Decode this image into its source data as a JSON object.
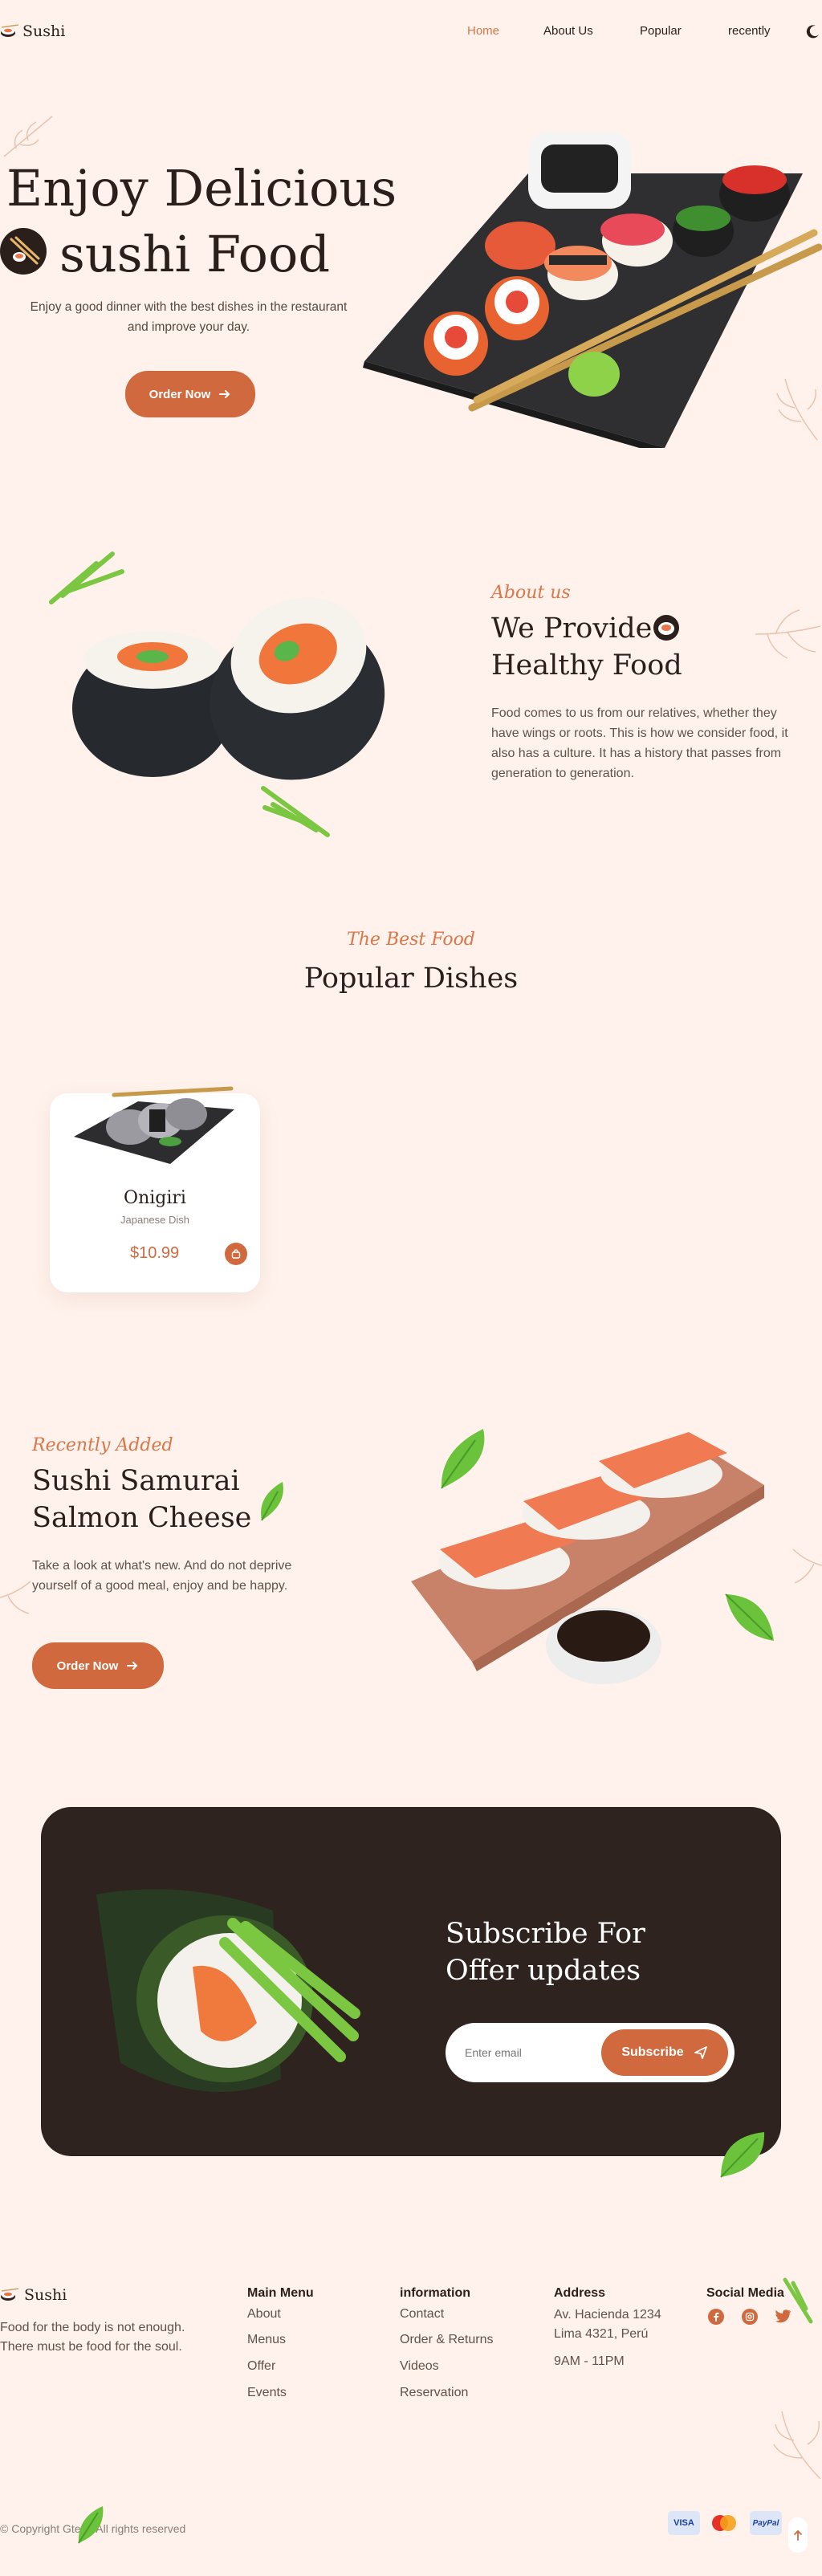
{
  "header": {
    "logo_text": "Sushi",
    "nav": [
      {
        "label": "Home",
        "active": true
      },
      {
        "label": "About Us",
        "active": false
      },
      {
        "label": "Popular",
        "active": false
      },
      {
        "label": "recently",
        "active": false
      }
    ],
    "theme_toggle_icon": "moon-icon"
  },
  "hero": {
    "title_line1": "Enjoy Delicious",
    "title_line2": "sushi Food",
    "description": "Enjoy a good dinner with the best dishes in the restaurant and improve your day.",
    "cta_label": "Order Now"
  },
  "about": {
    "label": "About us",
    "title_line1": "We Provide",
    "title_line2": "Healthy Food",
    "body": "Food comes to us from our relatives, whether they have wings or roots. This is how we consider food, it also has a culture. It has a history that passes from generation to generation."
  },
  "popular": {
    "label": "The Best Food",
    "title": "Popular Dishes",
    "items": [
      {
        "name": "Onigiri",
        "subtitle": "Japanese Dish",
        "price": "$10.99"
      }
    ]
  },
  "recent": {
    "label": "Recently Added",
    "title_line1": "Sushi Samurai",
    "title_line2": "Salmon Cheese",
    "body": "Take a look at what's new. And do not deprive yourself of a good meal, enjoy and be happy.",
    "cta_label": "Order Now"
  },
  "subscribe": {
    "title_line1": "Subscribe For",
    "title_line2": "Offer updates",
    "input_placeholder": "Enter email",
    "button_label": "Subscribe"
  },
  "footer": {
    "logo_text": "Sushi",
    "tagline": "Food for the body is not enough. There must be food for the soul.",
    "columns": [
      {
        "title": "Main Menu",
        "links": [
          "About",
          "Menus",
          "Offer",
          "Events"
        ]
      },
      {
        "title": "information",
        "links": [
          "Contact",
          "Order & Returns",
          "Videos",
          "Reservation"
        ]
      },
      {
        "title": "Address",
        "links": [
          "Av. Hacienda 1234",
          "Lima 4321, Perú",
          "9AM - 11PM"
        ]
      }
    ],
    "social_title": "Social Media",
    "social_icons": [
      "facebook-icon",
      "instagram-icon",
      "twitter-icon"
    ],
    "copyright": "© Copyright Gtech.All rights reserved",
    "payments": [
      "VISA",
      "mastercard",
      "PayPal"
    ]
  },
  "colors": {
    "background": "#FFF2EC",
    "accent": "#D0693E",
    "dark": "#2E231F",
    "text": "#2A1F1B"
  }
}
